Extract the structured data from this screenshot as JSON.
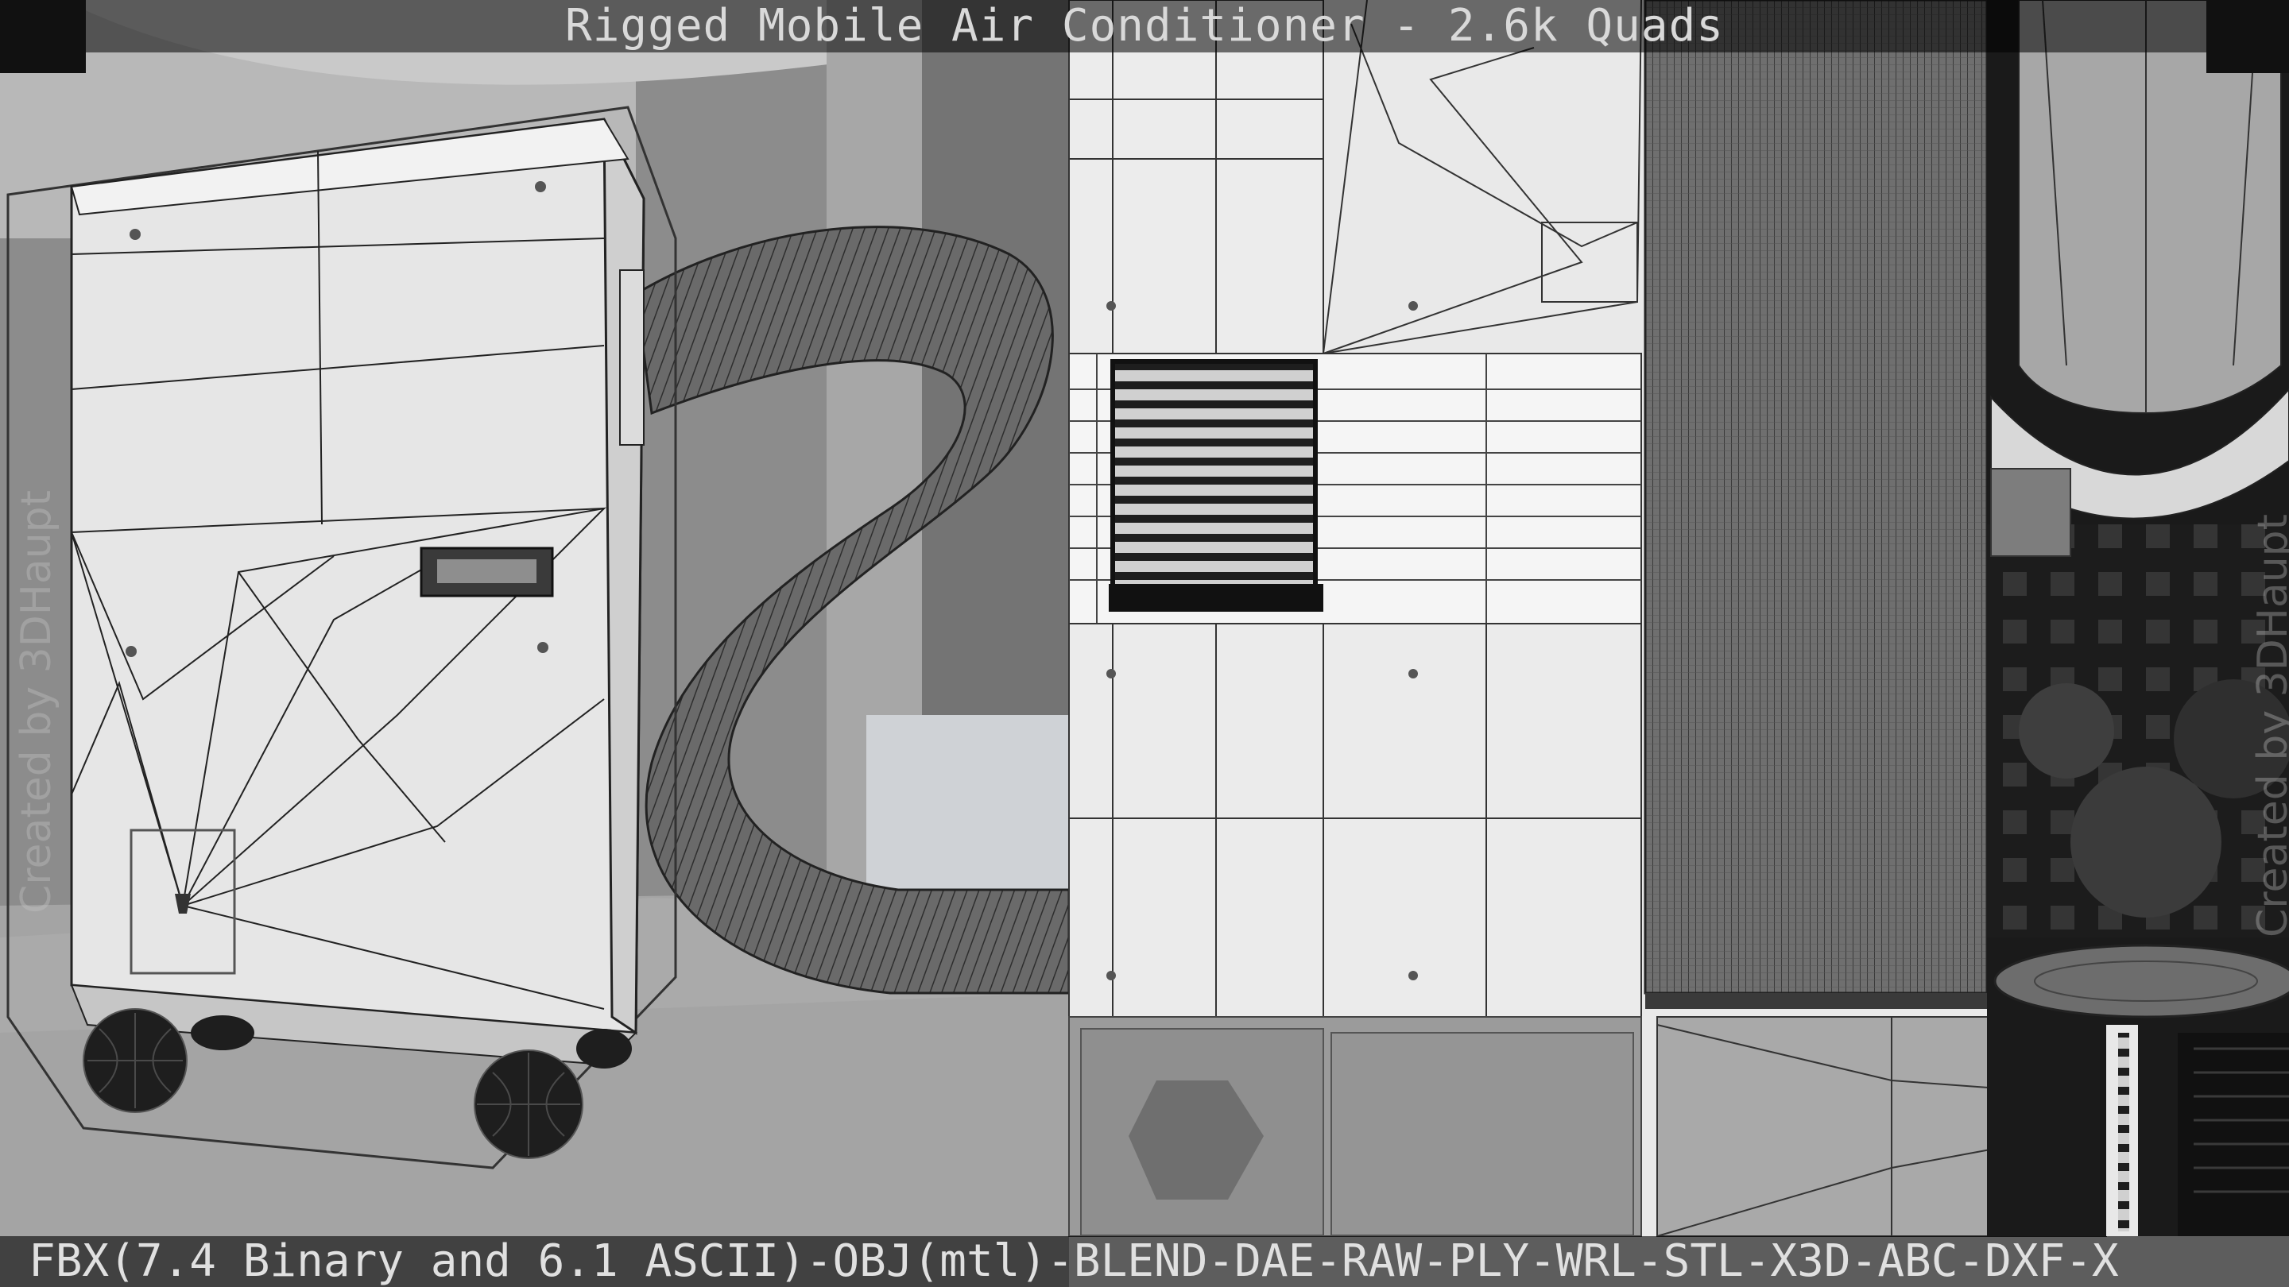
{
  "header": {
    "title": "Rigged Mobile Air Conditioner - 2.6k Quads"
  },
  "footer": {
    "formats": "FBX(7.4 Binary and 6.1 ASCII)-OBJ(mtl)-BLEND-DAE-RAW-PLY-WRL-STL-X3D-ABC-DXF-X"
  },
  "watermark": {
    "left": "Created by 3DHaupt",
    "right": "Created by 3DHaupt"
  },
  "colors": {
    "panel_white": "#ededed",
    "wire": "#222222",
    "hose": "#5e5e5e",
    "background_wall": "#8a8a8a",
    "floor": "#a8a8a8",
    "texture_dark": "#1b1b1b"
  }
}
